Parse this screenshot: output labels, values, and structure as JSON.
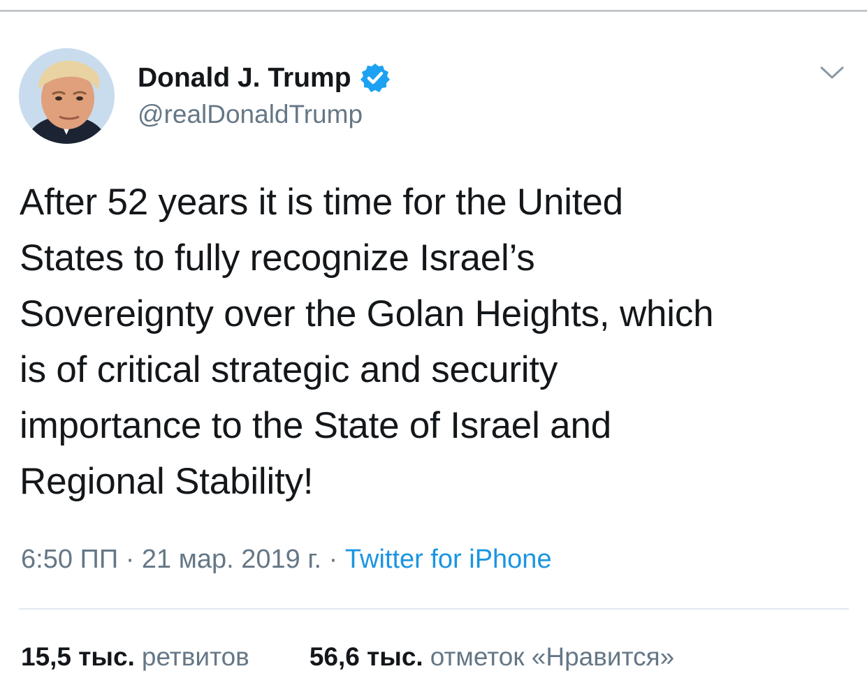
{
  "tweet": {
    "author": {
      "display_name": "Donald J. Trump",
      "handle": "@realDonaldTrump",
      "verified_icon": "verified-badge-icon",
      "avatar_icon": "profile-photo"
    },
    "menu_icon": "chevron-down-icon",
    "text_lines": [
      "After 52 years it is time for the United",
      "States to fully recognize Israel’s",
      "Sovereignty over the Golan Heights, which",
      "is of critical strategic and security",
      "importance to the State of Israel and",
      "Regional Stability!"
    ],
    "timestamp": "6:50 ПП · 21 мар. 2019 г. · ",
    "source": "Twitter for iPhone",
    "stats": {
      "retweets_count": "15,5 тыс.",
      "retweets_label": "ретвитов",
      "likes_count": "56,6 тыс.",
      "likes_label": "отметок «Нравится»"
    }
  },
  "colors": {
    "text_primary": "#14171a",
    "text_secondary": "#657786",
    "link_blue": "#1b95e0",
    "divider": "#e1e8ed"
  }
}
